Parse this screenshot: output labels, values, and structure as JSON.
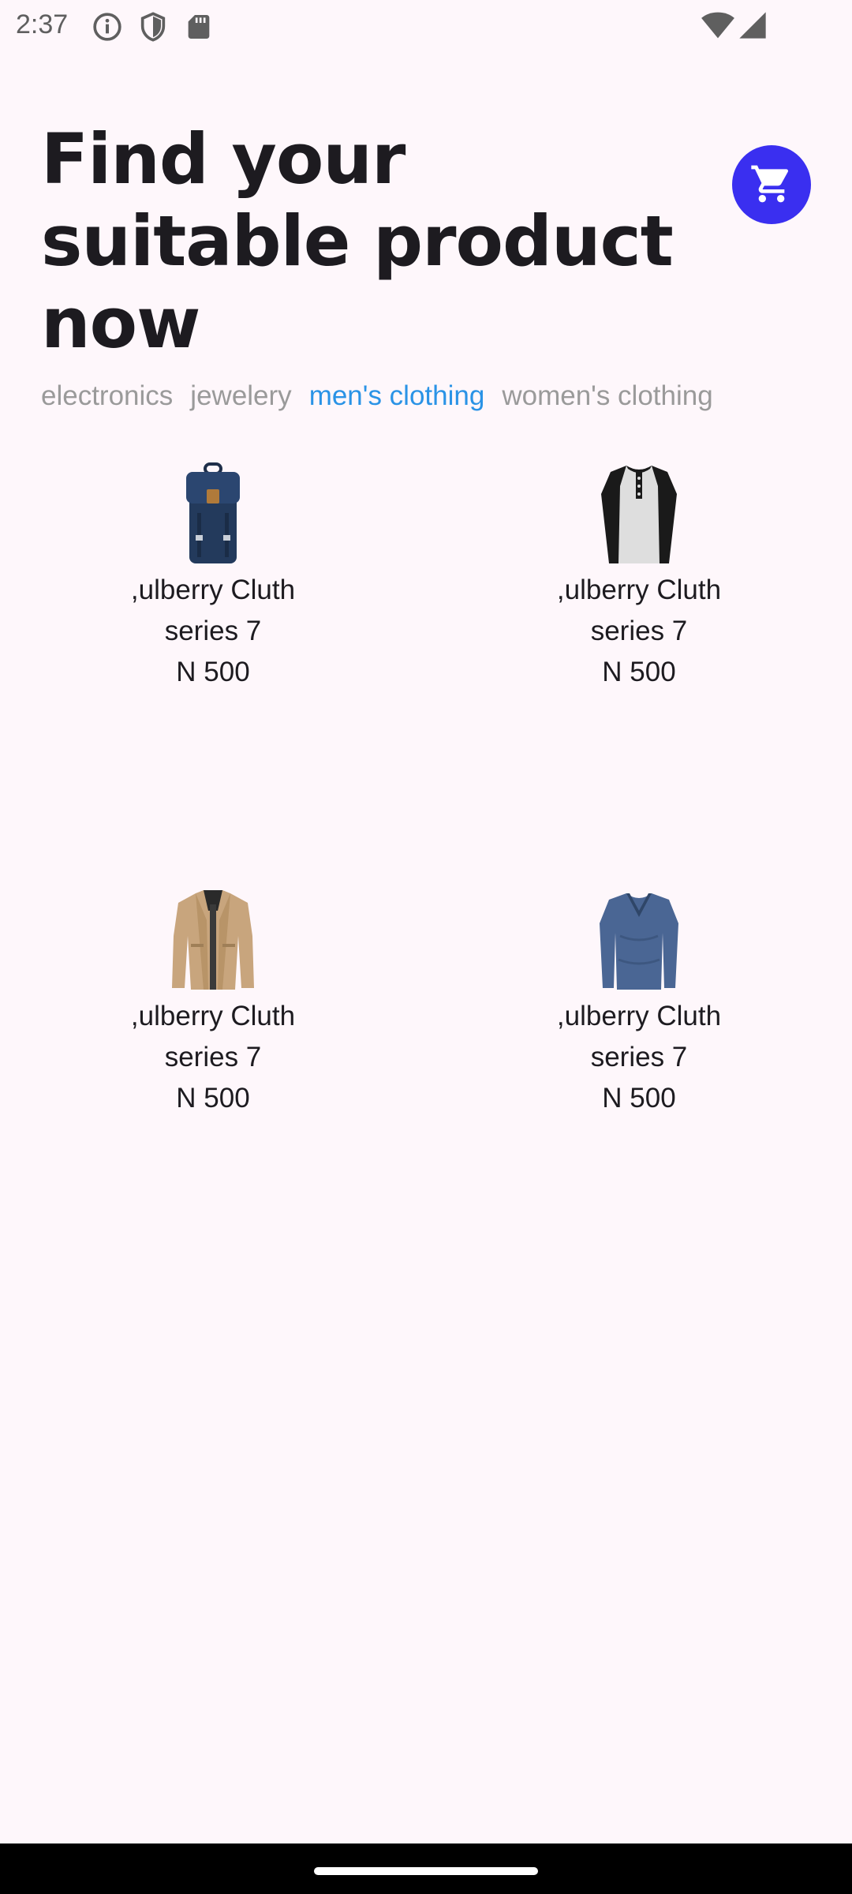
{
  "status_bar": {
    "time": "2:37",
    "icons_left": [
      "info-icon",
      "shield-icon",
      "sd-card-icon"
    ],
    "icons_right": [
      "wifi-icon",
      "cell-signal-icon"
    ]
  },
  "header": {
    "title": "Find your suitable product now",
    "cart_icon": "cart-icon",
    "accent_color": "#3a2ff0"
  },
  "categories": {
    "items": [
      "electronics",
      "jewelery",
      "men's clothing",
      "women's clothing"
    ],
    "selected": "men's clothing",
    "active_color": "#2a93e6",
    "inactive_color": "#9a9a9a"
  },
  "products": [
    {
      "name": ",ulberry Cluth series 7",
      "price": "N 500",
      "image": "backpack"
    },
    {
      "name": ",ulberry Cluth series 7",
      "price": "N 500",
      "image": "raglan-henley-shirt"
    },
    {
      "name": ",ulberry Cluth series 7",
      "price": "N 500",
      "image": "beige-jacket"
    },
    {
      "name": ",ulberry Cluth series 7",
      "price": "N 500",
      "image": "blue-long-sleeve-shirt"
    }
  ]
}
